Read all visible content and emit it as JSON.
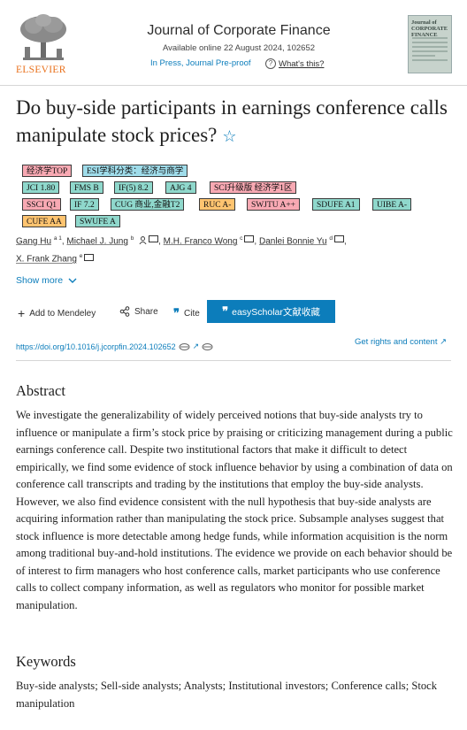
{
  "header": {
    "publisher": "ELSEVIER",
    "journal_title": "Journal of Corporate Finance",
    "available_online": "Available online 22 August 2024, 102652",
    "press_status": "In Press, Journal Pre-proof",
    "whats_this": "What's this?",
    "cover_title": "Journal of CORPORATE FINANCE"
  },
  "article": {
    "title": "Do buy-side participants in earnings conference calls manipulate stock prices?",
    "tags": [
      {
        "label": "经济学TOP",
        "color": "pink"
      },
      {
        "label": "ESI学科分类：经济与商学",
        "color": "blue"
      },
      {
        "label": "JCI 1.80",
        "color": "teal"
      },
      {
        "label": "FMS B",
        "color": "teal"
      },
      {
        "label": "IF(5) 8.2",
        "color": "teal"
      },
      {
        "label": "AJG 4",
        "color": "teal"
      },
      {
        "label": "SCI升级版 经济学1区",
        "color": "pink"
      },
      {
        "label": "SSCI Q1",
        "color": "pink"
      },
      {
        "label": "IF 7.2",
        "color": "teal"
      },
      {
        "label": "CUG 商业,金融T2",
        "color": "teal"
      },
      {
        "label": "RUC A-",
        "color": "orange"
      },
      {
        "label": "SWJTU A++",
        "color": "pink"
      },
      {
        "label": "SDUFE A1",
        "color": "teal"
      },
      {
        "label": "UIBE A-",
        "color": "teal"
      },
      {
        "label": "CUFE AA",
        "color": "orange"
      },
      {
        "label": "SWUFE A",
        "color": "teal"
      }
    ],
    "authors": [
      {
        "name": "Gang Hu",
        "sup": "a 1"
      },
      {
        "name": "Michael J. Jung",
        "sup": "b"
      },
      {
        "name": "M.H. Franco Wong",
        "sup": "c"
      },
      {
        "name": "Danlei Bonnie Yu",
        "sup": "d"
      },
      {
        "name": "X. Frank Zhang",
        "sup": "e"
      }
    ],
    "show_more": "Show more"
  },
  "actions": {
    "mendeley": "Add to Mendeley",
    "share": "Share",
    "cite": "Cite",
    "easyscholar": "easyScholar文献收藏",
    "doi": "https://doi.org/10.1016/j.jcorpfin.2024.102652",
    "rights": "Get rights and content"
  },
  "abstract": {
    "heading": "Abstract",
    "text": "We investigate the generalizability of widely perceived notions that buy-side analysts try to influence or manipulate a firm’s stock price by praising or criticizing management during a public earnings conference call. Despite two institutional factors that make it difficult to detect empirically, we find some evidence of stock influence behavior by using a combination of data on conference call transcripts and trading by the institutions that employ the buy-side analysts. However, we also find evidence consistent with the null hypothesis that buy-side analysts are acquiring information rather than manipulating the stock price. Subsample analyses suggest that stock influence is more detectable among hedge funds, while information acquisition is the norm among traditional buy-and-hold institutions. The evidence we provide on each behavior should be of interest to firm managers who host conference calls, market participants who use conference calls to collect company information, as well as regulators who monitor for possible market manipulation."
  },
  "keywords": {
    "heading": "Keywords",
    "text": "Buy-side analysts; Sell-side analysts; Analysts; Institutional investors; Conference calls; Stock manipulation"
  },
  "colors": {
    "accent": "#0c7dbb",
    "elsevier_orange": "#e9711c",
    "tag_pink": "#f8a9b3",
    "tag_blue": "#9fdcea",
    "tag_teal": "#8fd8cc",
    "tag_orange": "#ffc470"
  }
}
